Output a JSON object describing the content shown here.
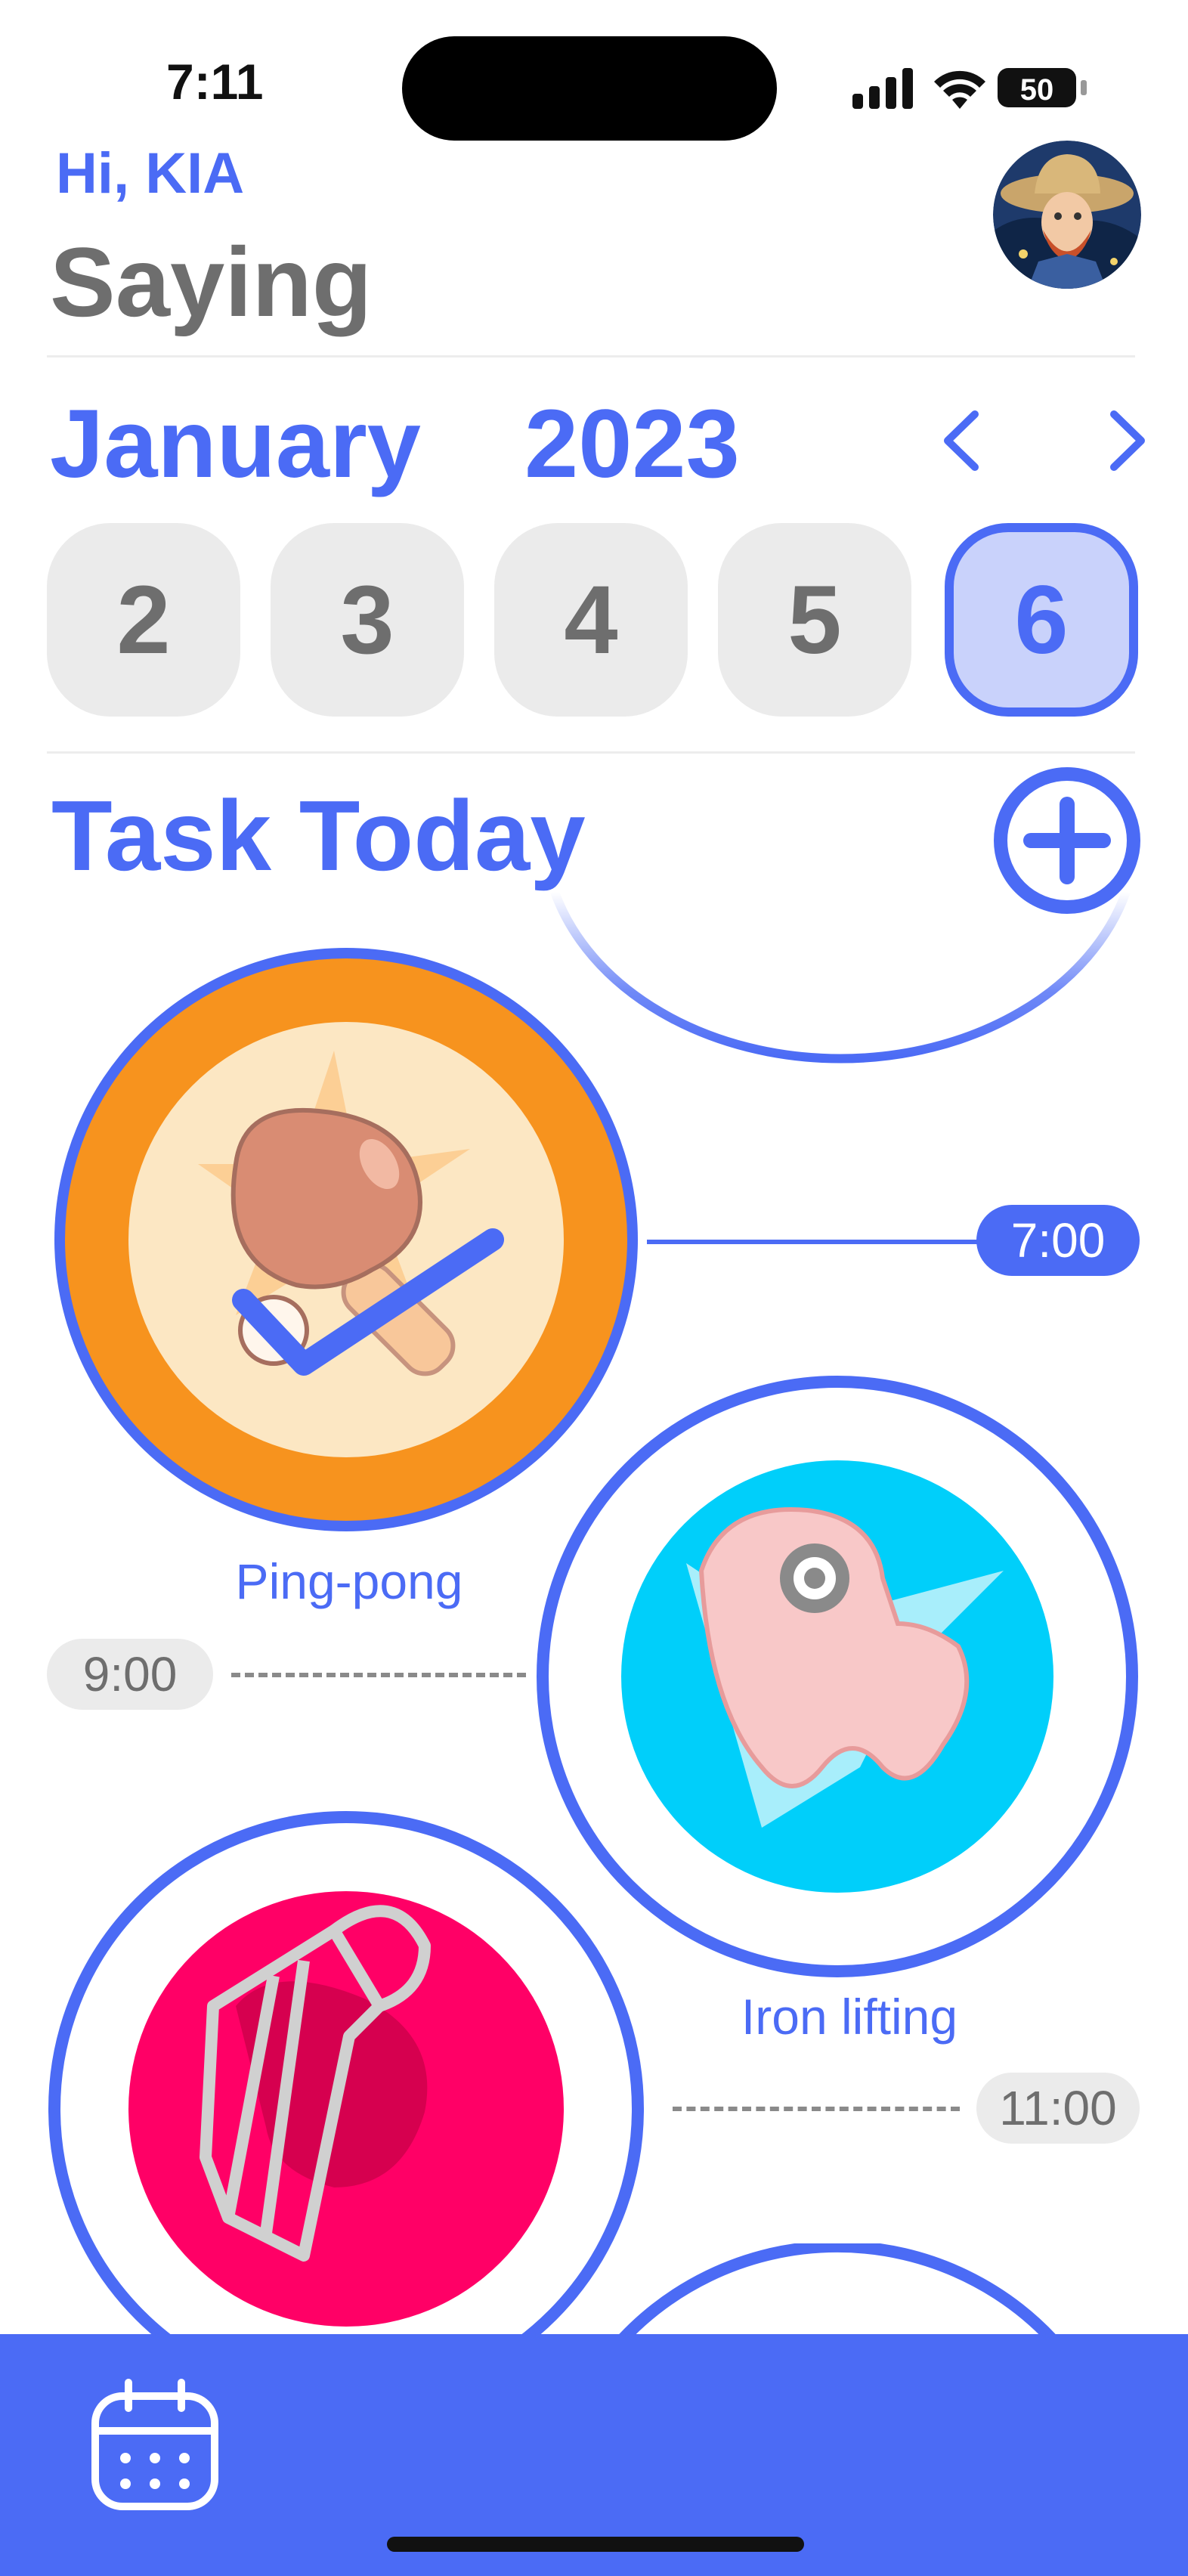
{
  "status": {
    "time": "7:11",
    "battery": "50"
  },
  "header": {
    "greeting": "Hi, KIA",
    "title": "Saying"
  },
  "calendar": {
    "month": "January",
    "year": "2023",
    "days": [
      "2",
      "3",
      "4",
      "5",
      "6"
    ],
    "selected_day": "6"
  },
  "tasks": {
    "section_title": "Task Today",
    "items": [
      {
        "name": "Ping-pong",
        "time": "7:00",
        "done": true
      },
      {
        "name": "Iron lifting",
        "time": "9:00",
        "done": false
      },
      {
        "name": "",
        "time": "11:00",
        "done": false
      }
    ]
  },
  "colors": {
    "accent": "#4B6BF5",
    "orange": "#F7931E",
    "cyan": "#00CFFA",
    "magenta": "#FF0066"
  },
  "icons": [
    "signal-icon",
    "wifi-icon",
    "battery-icon",
    "chevron-left-icon",
    "chevron-right-icon",
    "plus-circle-icon",
    "ping-pong-paddle-icon",
    "check-icon",
    "dumbbell-icon",
    "shuttlecock-icon",
    "calendar-icon"
  ]
}
